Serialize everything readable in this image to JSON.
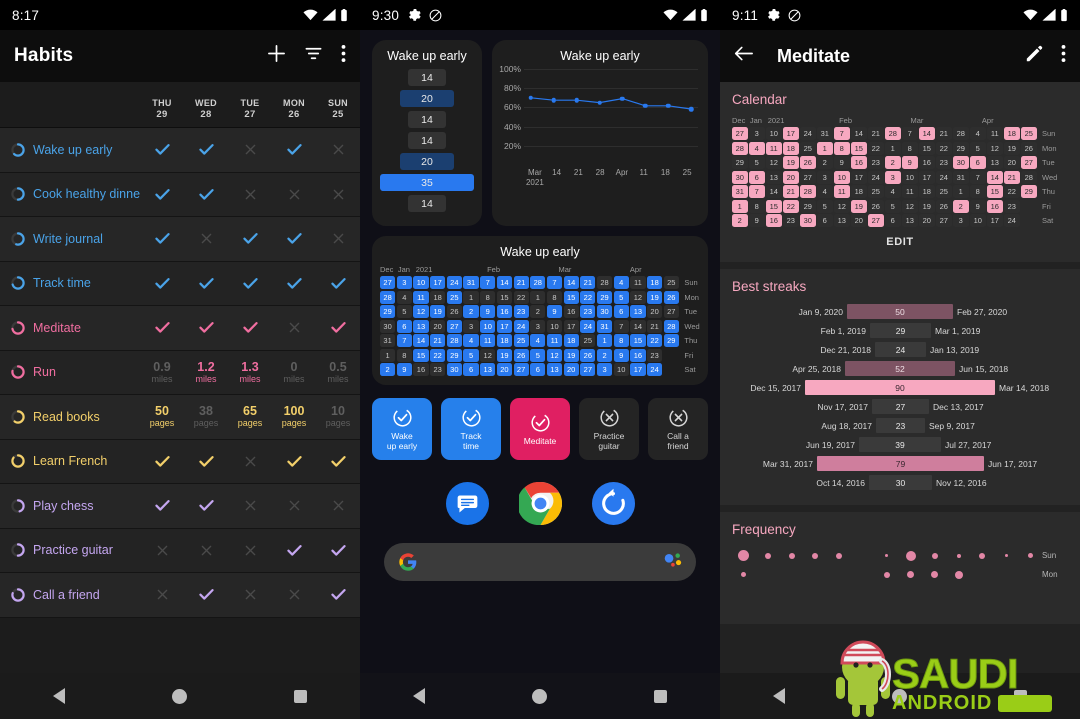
{
  "screens": {
    "habits_list": {
      "status": {
        "time": "8:17"
      },
      "appbar": {
        "title": "Habits",
        "add_label": "+",
        "filter_name": "filter-icon",
        "overflow_name": "overflow-menu-icon"
      },
      "columns": [
        {
          "dow": "THU",
          "day": "29"
        },
        {
          "dow": "WED",
          "day": "28"
        },
        {
          "dow": "TUE",
          "day": "27"
        },
        {
          "dow": "MON",
          "day": "26"
        },
        {
          "dow": "SUN",
          "day": "25"
        }
      ],
      "rows": [
        {
          "name": "Wake up early",
          "color": "#4aa3e8",
          "type": "check",
          "cells": [
            "check",
            "check",
            "cross",
            "check",
            "cross"
          ]
        },
        {
          "name": "Cook healthy dinner",
          "color": "#4aa3e8",
          "type": "check",
          "cells": [
            "check",
            "check",
            "cross",
            "cross",
            "cross"
          ]
        },
        {
          "name": "Write journal",
          "color": "#4aa3e8",
          "type": "check",
          "cells": [
            "check",
            "cross",
            "check",
            "check",
            "cross"
          ]
        },
        {
          "name": "Track time",
          "color": "#4aa3e8",
          "type": "check",
          "cells": [
            "check",
            "check",
            "check",
            "check",
            "check"
          ]
        },
        {
          "name": "Meditate",
          "color": "#f06ea0",
          "type": "check",
          "cells": [
            "check",
            "check",
            "check",
            "cross",
            "check"
          ]
        },
        {
          "name": "Run",
          "color": "#f06ea0",
          "type": "number",
          "unit": "miles",
          "cells": [
            "0.9",
            "1.2",
            "1.3",
            "0",
            "0.5"
          ],
          "highlight": [
            false,
            true,
            true,
            false,
            false
          ]
        },
        {
          "name": "Read books",
          "color": "#f2cf6a",
          "type": "number",
          "unit": "pages",
          "cells": [
            "50",
            "38",
            "65",
            "100",
            "10"
          ],
          "highlight": [
            true,
            false,
            true,
            true,
            false
          ]
        },
        {
          "name": "Learn French",
          "color": "#f2cf6a",
          "type": "check",
          "cells": [
            "check",
            "check",
            "cross",
            "check",
            "check"
          ]
        },
        {
          "name": "Play chess",
          "color": "#c4a6f0",
          "type": "check",
          "cells": [
            "check",
            "check",
            "cross",
            "cross",
            "cross"
          ]
        },
        {
          "name": "Practice guitar",
          "color": "#c4a6f0",
          "type": "check",
          "cells": [
            "cross",
            "cross",
            "cross",
            "check",
            "check"
          ]
        },
        {
          "name": "Call a friend",
          "color": "#c4a6f0",
          "type": "check",
          "cells": [
            "cross",
            "check",
            "cross",
            "cross",
            "check"
          ]
        }
      ]
    },
    "widgets": {
      "status": {
        "time": "9:30"
      },
      "bar_widget": {
        "title": "Wake up early",
        "values": [
          14,
          20,
          14,
          14,
          20,
          35,
          14
        ],
        "max": 35
      },
      "line_widget": {
        "title": "Wake up early",
        "ylabels": [
          "100%",
          "80%",
          "60%",
          "40%",
          "20%"
        ],
        "xlabels": [
          "Mar\n2021",
          "14",
          "21",
          "28",
          "Apr",
          "11",
          "18",
          "25"
        ]
      },
      "calendar_widget": {
        "title": "Wake up early",
        "months": [
          "Dec",
          "Jan",
          "2021",
          "Feb",
          "Mar",
          "Apr"
        ],
        "dows": [
          "Sun",
          "Mon",
          "Tue",
          "Wed",
          "Thu",
          "Fri",
          "Sat"
        ],
        "rows": [
          {
            "days": [
              27,
              3,
              10,
              17,
              24,
              31,
              7,
              14,
              21,
              28,
              7,
              14,
              21,
              28,
              4,
              11,
              18,
              25
            ],
            "on": [
              1,
              1,
              1,
              1,
              1,
              1,
              1,
              1,
              1,
              1,
              1,
              1,
              1,
              0,
              1,
              0,
              1,
              0
            ]
          },
          {
            "days": [
              28,
              4,
              11,
              18,
              25,
              1,
              8,
              15,
              22,
              1,
              8,
              15,
              22,
              29,
              5,
              12,
              19,
              26
            ],
            "on": [
              1,
              0,
              1,
              0,
              1,
              0,
              0,
              0,
              0,
              0,
              0,
              1,
              1,
              1,
              1,
              0,
              1,
              1
            ]
          },
          {
            "days": [
              29,
              5,
              12,
              19,
              26,
              2,
              9,
              16,
              23,
              2,
              9,
              16,
              23,
              30,
              6,
              13,
              20,
              27
            ],
            "on": [
              1,
              0,
              1,
              1,
              0,
              1,
              1,
              1,
              1,
              0,
              1,
              0,
              1,
              1,
              1,
              1,
              0,
              0
            ]
          },
          {
            "days": [
              30,
              6,
              13,
              20,
              27,
              3,
              10,
              17,
              24,
              3,
              10,
              17,
              24,
              31,
              7,
              14,
              21,
              28
            ],
            "on": [
              0,
              1,
              1,
              0,
              1,
              0,
              1,
              1,
              1,
              0,
              0,
              0,
              1,
              1,
              0,
              0,
              0,
              1
            ]
          },
          {
            "days": [
              31,
              7,
              14,
              21,
              28,
              4,
              11,
              18,
              25,
              4,
              11,
              18,
              25,
              1,
              8,
              15,
              22,
              29
            ],
            "on": [
              0,
              1,
              1,
              1,
              1,
              1,
              1,
              1,
              1,
              1,
              1,
              1,
              0,
              1,
              1,
              1,
              1,
              1
            ]
          },
          {
            "days": [
              1,
              8,
              15,
              22,
              29,
              5,
              12,
              19,
              26,
              5,
              12,
              19,
              26,
              2,
              9,
              16,
              23,
              0
            ],
            "on": [
              0,
              0,
              1,
              1,
              1,
              1,
              0,
              1,
              1,
              1,
              1,
              1,
              1,
              1,
              1,
              1,
              0,
              0
            ]
          },
          {
            "days": [
              2,
              9,
              16,
              23,
              30,
              6,
              13,
              20,
              27,
              6,
              13,
              20,
              27,
              3,
              10,
              17,
              24,
              0
            ],
            "on": [
              1,
              1,
              0,
              0,
              1,
              1,
              1,
              1,
              1,
              1,
              1,
              1,
              1,
              1,
              0,
              1,
              1,
              0
            ]
          }
        ]
      },
      "habit_buttons": [
        {
          "label": "Wake\nup early",
          "state": "done",
          "color": "blue",
          "icon": "check-circle-icon"
        },
        {
          "label": "Track\ntime",
          "state": "done",
          "color": "blue",
          "icon": "check-circle-icon"
        },
        {
          "label": "Meditate",
          "state": "done",
          "color": "pink",
          "icon": "check-circle-icon"
        },
        {
          "label": "Practice\nguitar",
          "state": "off",
          "color": "dark",
          "icon": "cross-circle-icon"
        },
        {
          "label": "Call a\nfriend",
          "state": "off",
          "color": "dark",
          "icon": "cross-circle-icon"
        }
      ],
      "dock": [
        {
          "name": "messages-icon"
        },
        {
          "name": "chrome-icon"
        },
        {
          "name": "loop-habit-tracker-icon"
        }
      ],
      "search": {
        "left_icon": "google-g-icon",
        "right_icon": "google-assistant-icon",
        "placeholder": ""
      }
    },
    "detail": {
      "status": {
        "time": "9:11"
      },
      "appbar": {
        "back_name": "back-arrow-icon",
        "title": "Meditate",
        "edit_name": "pencil-icon",
        "overflow_name": "overflow-menu-icon"
      },
      "calendar": {
        "heading": "Calendar",
        "months": [
          "Dec",
          "Jan",
          "2021",
          "Feb",
          "Mar",
          "Apr"
        ],
        "dows": [
          "Sun",
          "Mon",
          "Tue",
          "Wed",
          "Thu",
          "Fri",
          "Sat"
        ],
        "edit_label": "EDIT",
        "rows": [
          {
            "days": [
              27,
              3,
              10,
              17,
              24,
              31,
              7,
              14,
              21,
              28,
              7,
              14,
              21,
              28,
              4,
              11,
              18,
              25
            ],
            "on": [
              1,
              0,
              0,
              1,
              0,
              0,
              1,
              0,
              0,
              1,
              0,
              1,
              0,
              0,
              0,
              0,
              1,
              1
            ]
          },
          {
            "days": [
              28,
              4,
              11,
              18,
              25,
              1,
              8,
              15,
              22,
              1,
              8,
              15,
              22,
              29,
              5,
              12,
              19,
              26
            ],
            "on": [
              1,
              1,
              1,
              1,
              0,
              1,
              1,
              1,
              0,
              0,
              0,
              0,
              0,
              0,
              0,
              0,
              0,
              0
            ]
          },
          {
            "days": [
              29,
              5,
              12,
              19,
              26,
              2,
              9,
              16,
              23,
              2,
              9,
              16,
              23,
              30,
              6,
              13,
              20,
              27
            ],
            "on": [
              0,
              0,
              0,
              1,
              1,
              0,
              0,
              1,
              0,
              1,
              1,
              0,
              0,
              1,
              1,
              0,
              0,
              1
            ]
          },
          {
            "days": [
              30,
              6,
              13,
              20,
              27,
              3,
              10,
              17,
              24,
              3,
              10,
              17,
              24,
              31,
              7,
              14,
              21,
              28
            ],
            "on": [
              1,
              1,
              0,
              1,
              0,
              0,
              1,
              0,
              0,
              1,
              0,
              0,
              0,
              0,
              0,
              1,
              1,
              0
            ]
          },
          {
            "days": [
              31,
              7,
              14,
              21,
              28,
              4,
              11,
              18,
              25,
              4,
              11,
              18,
              25,
              1,
              8,
              15,
              22,
              29
            ],
            "on": [
              1,
              1,
              0,
              1,
              1,
              0,
              1,
              0,
              0,
              0,
              0,
              0,
              0,
              0,
              0,
              1,
              0,
              1
            ]
          },
          {
            "days": [
              1,
              8,
              15,
              22,
              29,
              5,
              12,
              19,
              26,
              5,
              12,
              19,
              26,
              2,
              9,
              16,
              23,
              0
            ],
            "on": [
              1,
              0,
              1,
              1,
              0,
              0,
              0,
              1,
              0,
              0,
              0,
              0,
              0,
              1,
              0,
              1,
              0,
              0
            ]
          },
          {
            "days": [
              2,
              9,
              16,
              23,
              30,
              6,
              13,
              20,
              27,
              6,
              13,
              20,
              27,
              3,
              10,
              17,
              24,
              0
            ],
            "on": [
              1,
              0,
              1,
              0,
              1,
              0,
              0,
              0,
              1,
              0,
              0,
              0,
              0,
              0,
              0,
              0,
              0,
              0
            ]
          }
        ]
      },
      "best_streaks": {
        "heading": "Best streaks",
        "max": 90,
        "items": [
          {
            "start": "Jan 9, 2020",
            "length": 50,
            "end": "Feb 27, 2020",
            "shade": "mid"
          },
          {
            "start": "Feb 1, 2019",
            "length": 29,
            "end": "Mar 1, 2019",
            "shade": "low"
          },
          {
            "start": "Dec 21, 2018",
            "length": 24,
            "end": "Jan 13, 2019",
            "shade": "low"
          },
          {
            "start": "Apr 25, 2018",
            "length": 52,
            "end": "Jun 15, 2018",
            "shade": "mid"
          },
          {
            "start": "Dec 15, 2017",
            "length": 90,
            "end": "Mar 14, 2018",
            "shade": "high"
          },
          {
            "start": "Nov 17, 2017",
            "length": 27,
            "end": "Dec 13, 2017",
            "shade": "low"
          },
          {
            "start": "Aug 18, 2017",
            "length": 23,
            "end": "Sep 9, 2017",
            "shade": "low"
          },
          {
            "start": "Jun 19, 2017",
            "length": 39,
            "end": "Jul 27, 2017",
            "shade": "low"
          },
          {
            "start": "Mar 31, 2017",
            "length": 79,
            "end": "Jun 17, 2017",
            "shade": "midhigh"
          },
          {
            "start": "Oct 14, 2016",
            "length": 30,
            "end": "Nov 12, 2016",
            "shade": "low"
          }
        ]
      },
      "frequency": {
        "heading": "Frequency",
        "dows": [
          "Sun",
          "Mon"
        ],
        "rows": [
          {
            "dow": "Sun",
            "sizes": [
              11,
              6,
              6,
              6,
              6,
              0,
              3,
              10,
              6,
              4,
              6,
              3,
              5
            ]
          },
          {
            "dow": "Mon",
            "sizes": [
              5,
              0,
              0,
              0,
              0,
              0,
              6,
              7,
              7,
              8,
              0,
              0,
              0
            ]
          }
        ]
      }
    }
  },
  "watermark": {
    "line1": "SAUDI",
    "line2": "ANDROID",
    "mascot": "android-mascot-keffiyeh-icon"
  },
  "navbar": {
    "back": "nav-back-icon",
    "home": "nav-home-icon",
    "recents": "nav-recents-icon"
  },
  "colors": {
    "blue": "#2979ef",
    "pink": "#f7a8c0",
    "accent_pink": "#f06ea0",
    "yellow": "#f2cf6a",
    "purple": "#c4a6f0",
    "green": "#9acd17"
  }
}
